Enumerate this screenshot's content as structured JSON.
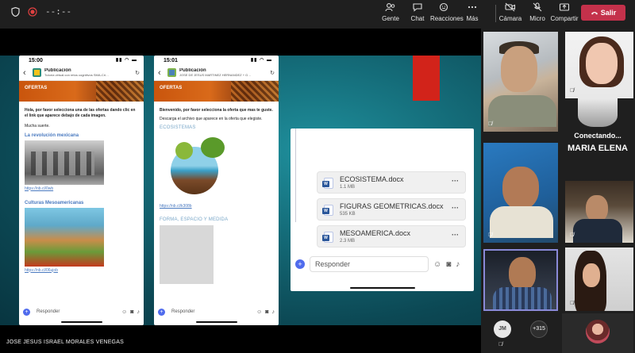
{
  "topbar": {
    "timer": "--:--",
    "buttons": [
      {
        "label": "Gente",
        "icon": "people-icon"
      },
      {
        "label": "Chat",
        "icon": "chat-icon"
      },
      {
        "label": "Reacciones",
        "icon": "reaction-icon"
      },
      {
        "label": "Más",
        "icon": "more-icon"
      },
      {
        "label": "Cámara",
        "icon": "camera-off-icon"
      },
      {
        "label": "Micro",
        "icon": "mic-off-icon"
      },
      {
        "label": "Compartir",
        "icon": "share-icon"
      }
    ],
    "leave_label": "Salir"
  },
  "shared_screen": {
    "phone1": {
      "time": "15:00",
      "channel_title": "Publicación",
      "channel_sub": "Tutoría virtual con retos cognitivos SMA-Cri…",
      "banner": "OFERTAS",
      "message": "Hola, por favor selecciona una de las ofertas dando clic en el link que aparece debajo de cada imagen.",
      "thanks": "Mucha suerte.",
      "item1_title": "La revolución mexicana",
      "item1_link": "https://nb.cl/0wb",
      "item2_title": "Culturas Mesoamericanas",
      "item2_link": "https://nb.cl/06ujob",
      "reply_placeholder": "Responder"
    },
    "phone2": {
      "time": "15:01",
      "channel_title": "Publicación",
      "channel_sub": "JOSE DE JESUS MARTINEZ HERNANDEZ + G…",
      "banner": "OFERTAS",
      "message": "Bienvenido, por favor selecciona la oferta que mas te guste.",
      "instruction": "Descarga el archivo que aparece en la oferta que elegiste.",
      "item1_title": "ECOSISTEMAS",
      "item1_link": "https://nb.cl/k308b",
      "item2_title": "FORMA, ESPACIO Y MEDIDA",
      "reply_placeholder": "Responder"
    },
    "files": [
      {
        "name": "ECOSISTEMA.docx",
        "size": "1.1 MB"
      },
      {
        "name": "FIGURAS GEOMETRICAS.docx",
        "size": "535 KB"
      },
      {
        "name": "MESOAMERICA.docx",
        "size": "2.3 MB"
      }
    ],
    "files_reply_placeholder": "Responder",
    "presenter_name": "JOSE JESUS ISRAEL MORALES VENEGAS"
  },
  "gallery": {
    "connecting_label": "Conectando...",
    "connecting_name": "MARIA ELENA",
    "jm_initials": "JM",
    "more_count": "+315"
  }
}
